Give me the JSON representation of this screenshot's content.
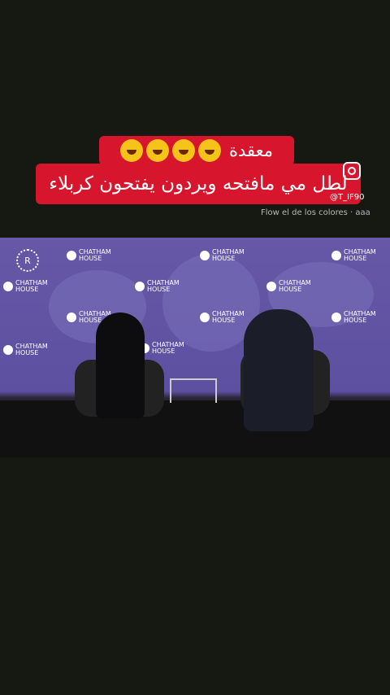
{
  "caption": {
    "line1": "معقدة",
    "line2": "لطل مي مافتحه ويردون يفتحون كربلاء",
    "emoji_icon": "rolling-laughing-emoji",
    "emoji_count": 4
  },
  "watermark": {
    "handle": "@T_IF90"
  },
  "music": {
    "label": "Flow el de los colores · aaa"
  },
  "video": {
    "brand": {
      "name_line1": "CHATHAM",
      "name_line2": "HOUSE",
      "r_logo": "R"
    }
  }
}
